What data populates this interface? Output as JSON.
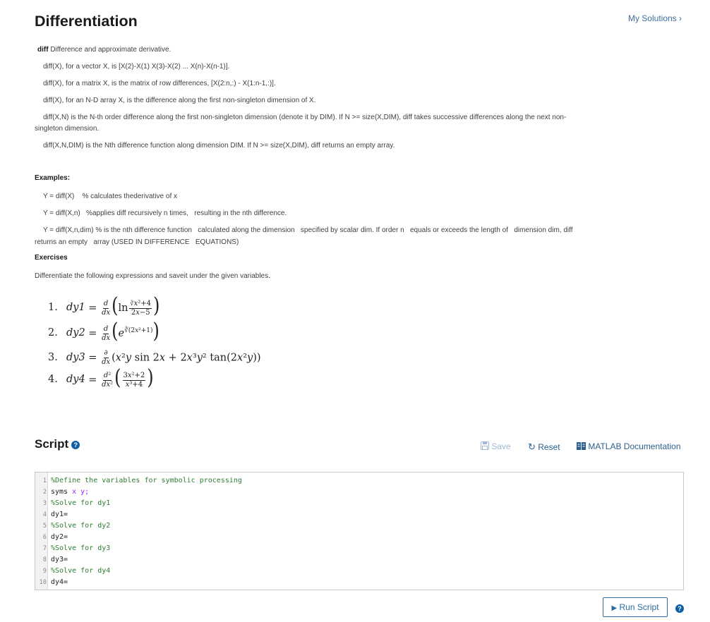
{
  "header": {
    "title": "Differentiation",
    "my_solutions": "My Solutions ›"
  },
  "description": {
    "lead_bold": "diff",
    "lead_rest": " Difference and approximate derivative.",
    "lines": [
      "diff(X), for a vector X, is [X(2)-X(1)  X(3)-X(2) ... X(n)-X(n-1)].",
      "diff(X), for a matrix X, is the matrix of row differences, [X(2:n,:) - X(1:n-1,:)].",
      "diff(X), for an N-D array X, is the difference along the first non-singleton dimension of X.",
      "diff(X,N) is the N-th order difference along the first non-singleton dimension (denote it by DIM). If N >= size(X,DIM), diff takes successive differences along the next non-",
      "singleton dimension.",
      "diff(X,N,DIM) is the Nth difference function along dimension DIM.  If N >= size(X,DIM), diff returns an empty array."
    ]
  },
  "examples": {
    "label": "Examples:",
    "lines": [
      "Y = diff(X)    % calculates thederivative of x",
      "Y = diff(X,n)   %applies diff recursively n times,   resulting in the nth difference.",
      "Y = diff(X,n,dim) % is the nth difference function   calculated along the dimension   specified by scalar dim. If order n   equals or exceeds the length of   dimension dim, diff",
      "returns an empty   array (USED IN DIFFERENCE   EQUATIONS)"
    ]
  },
  "exercises": {
    "label": "Exercises",
    "instruction": "Differentiate the following expressions and saveit under the given variables.",
    "items": [
      {
        "num": "1.",
        "var": "dy1"
      },
      {
        "num": "2.",
        "var": "dy2"
      },
      {
        "num": "3.",
        "var": "dy3"
      },
      {
        "num": "4.",
        "var": "dy4"
      }
    ]
  },
  "script": {
    "title": "Script",
    "help_icon": "question-circle-icon",
    "save_label": "Save",
    "reset_label": "Reset",
    "docs_label": "MATLAB Documentation",
    "run_label": "Run Script"
  },
  "editor": {
    "lines": [
      {
        "n": "1",
        "text": "%Define the variables for symbolic processing"
      },
      {
        "n": "2",
        "text": "syms x y;"
      },
      {
        "n": "3",
        "text": "%Solve for dy1"
      },
      {
        "n": "4",
        "text": "dy1="
      },
      {
        "n": "5",
        "text": "%Solve for dy2"
      },
      {
        "n": "6",
        "text": "dy2="
      },
      {
        "n": "7",
        "text": "%Solve for dy3"
      },
      {
        "n": "8",
        "text": "dy3="
      },
      {
        "n": "9",
        "text": "%Solve for dy4"
      },
      {
        "n": "10",
        "text": "dy4="
      }
    ]
  },
  "colors": {
    "link": "#3d6f9c",
    "accent": "#0f5fa6",
    "comment": "#2e7d32"
  }
}
